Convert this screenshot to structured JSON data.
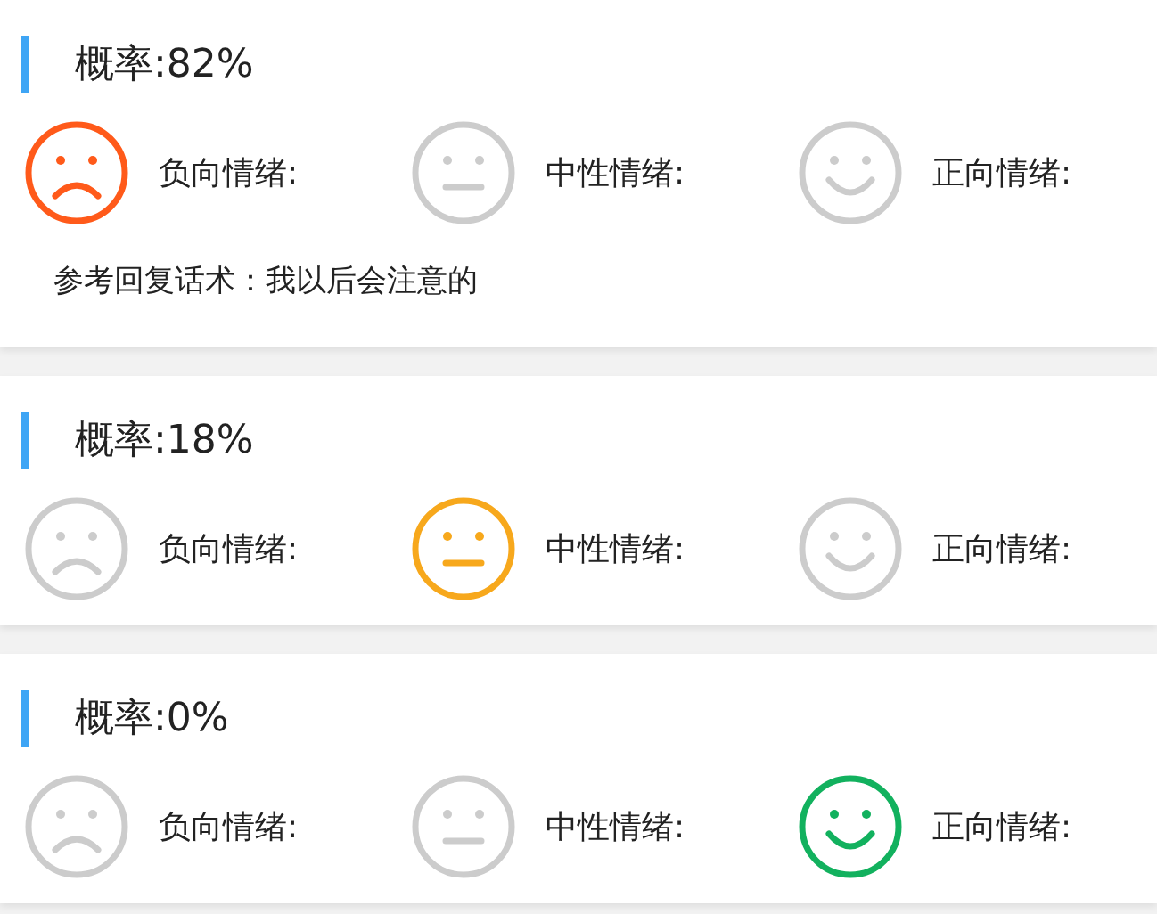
{
  "cards": [
    {
      "probability": "概率:82%",
      "emotions": [
        {
          "kind": "negative",
          "label": "负向情绪:",
          "selected": true,
          "color": "#ff5a1a"
        },
        {
          "kind": "neutral",
          "label": "中性情绪:",
          "selected": false
        },
        {
          "kind": "positive",
          "label": "正向情绪:",
          "selected": false
        }
      ],
      "reply": "参考回复话术：我以后会注意的"
    },
    {
      "probability": "概率:18%",
      "emotions": [
        {
          "kind": "negative",
          "label": "负向情绪:",
          "selected": false
        },
        {
          "kind": "neutral",
          "label": "中性情绪:",
          "selected": true,
          "color": "#f7a81c"
        },
        {
          "kind": "positive",
          "label": "正向情绪:",
          "selected": false
        }
      ]
    },
    {
      "probability": "概率:0%",
      "emotions": [
        {
          "kind": "negative",
          "label": "负向情绪:",
          "selected": false
        },
        {
          "kind": "neutral",
          "label": "中性情绪:",
          "selected": false
        },
        {
          "kind": "positive",
          "label": "正向情绪:",
          "selected": true,
          "color": "#12b15e"
        }
      ]
    }
  ]
}
